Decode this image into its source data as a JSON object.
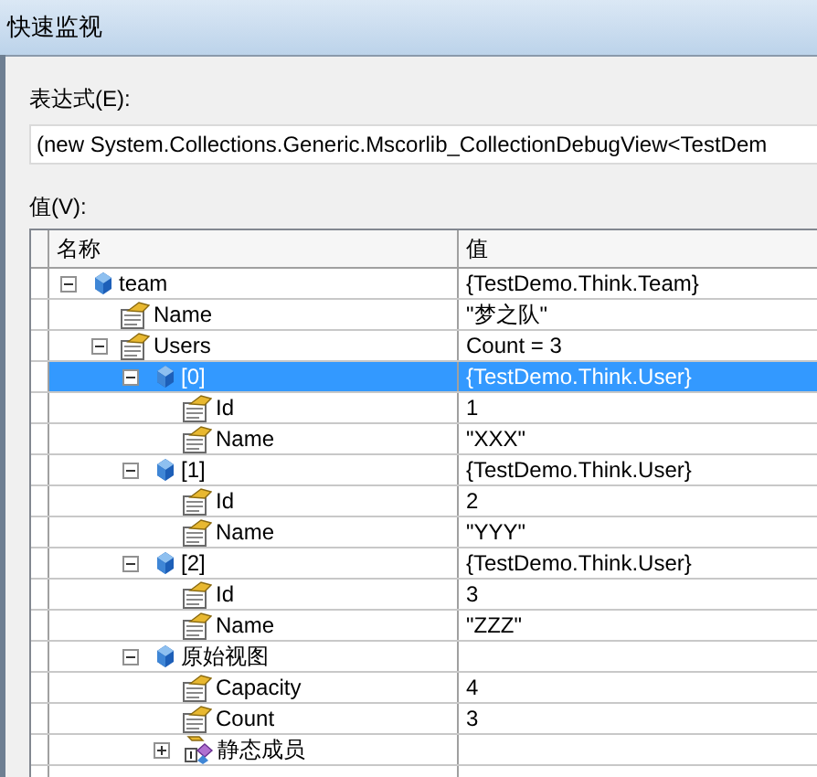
{
  "window": {
    "title": "快速监视"
  },
  "expression": {
    "label": "表达式(E):",
    "value": "(new System.Collections.Generic.Mscorlib_CollectionDebugView<TestDem"
  },
  "value_label": "值(V):",
  "table": {
    "columns": [
      "名称",
      "值"
    ],
    "rows": [
      {
        "name": "team",
        "value": "{TestDemo.Think.Team}",
        "kind": "object",
        "expanded": true,
        "selected": false,
        "children": [
          {
            "name": "Name",
            "value": "\"梦之队\"",
            "kind": "property",
            "selected": false
          },
          {
            "name": "Users",
            "value": "Count = 3",
            "kind": "property",
            "expanded": true,
            "selected": false,
            "children": [
              {
                "name": "[0]",
                "value": "{TestDemo.Think.User}",
                "kind": "object",
                "expanded": true,
                "selected": true,
                "children": [
                  {
                    "name": "Id",
                    "value": "1",
                    "kind": "property",
                    "selected": false
                  },
                  {
                    "name": "Name",
                    "value": "\"XXX\"",
                    "kind": "property",
                    "selected": false
                  }
                ]
              },
              {
                "name": "[1]",
                "value": "{TestDemo.Think.User}",
                "kind": "object",
                "expanded": true,
                "selected": false,
                "children": [
                  {
                    "name": "Id",
                    "value": "2",
                    "kind": "property",
                    "selected": false
                  },
                  {
                    "name": "Name",
                    "value": "\"YYY\"",
                    "kind": "property",
                    "selected": false
                  }
                ]
              },
              {
                "name": "[2]",
                "value": "{TestDemo.Think.User}",
                "kind": "object",
                "expanded": true,
                "selected": false,
                "children": [
                  {
                    "name": "Id",
                    "value": "3",
                    "kind": "property",
                    "selected": false
                  },
                  {
                    "name": "Name",
                    "value": "\"ZZZ\"",
                    "kind": "property",
                    "selected": false
                  }
                ]
              },
              {
                "name": "原始视图",
                "kind": "object",
                "expanded": true,
                "selected": false,
                "children": [
                  {
                    "name": "Capacity",
                    "value": "4",
                    "kind": "property",
                    "selected": false
                  },
                  {
                    "name": "Count",
                    "value": "3",
                    "kind": "property",
                    "selected": false
                  },
                  {
                    "name": "静态成员",
                    "kind": "static",
                    "expanded": false,
                    "selected": false
                  }
                ]
              }
            ]
          }
        ]
      }
    ]
  }
}
